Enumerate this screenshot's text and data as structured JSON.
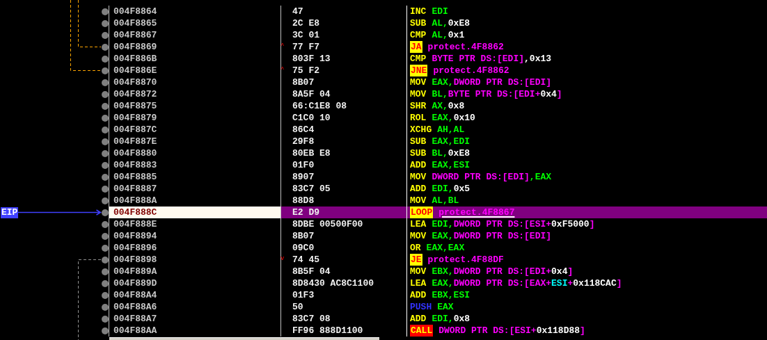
{
  "eip_label": "EIP",
  "rows": [
    {
      "address": "004F8864",
      "bytes": "47",
      "selected": false,
      "instruction": [
        {
          "text": "INC",
          "kind": "mnemonic"
        },
        {
          "text": "EDI",
          "kind": "register"
        }
      ]
    },
    {
      "address": "004F8865",
      "bytes": "2C E8",
      "selected": false,
      "instruction": [
        {
          "text": "SUB",
          "kind": "mnemonic"
        },
        {
          "text": "AL,",
          "kind": "register"
        },
        {
          "text": "0xE8",
          "kind": "number"
        }
      ]
    },
    {
      "address": "004F8867",
      "bytes": "3C 01",
      "selected": false,
      "instruction": [
        {
          "text": "CMP",
          "kind": "mnemonic"
        },
        {
          "text": "AL,",
          "kind": "register"
        },
        {
          "text": "0x1",
          "kind": "number"
        }
      ]
    },
    {
      "address": "004F8869",
      "bytes": "77 F7",
      "jump_mark": "^",
      "selected": false,
      "instruction": [
        {
          "text": "JA",
          "kind": "jump"
        },
        {
          "text": "protect.4F8862",
          "kind": "label"
        }
      ]
    },
    {
      "address": "004F886B",
      "bytes": "803F 13",
      "selected": false,
      "instruction": [
        {
          "text": "CMP",
          "kind": "mnemonic"
        },
        {
          "text": "BYTE PTR DS:[EDI]",
          "kind": "memory"
        },
        {
          "text": ",0x13",
          "kind": "number"
        }
      ]
    },
    {
      "address": "004F886E",
      "bytes": "75 F2",
      "jump_mark": "^",
      "selected": false,
      "instruction": [
        {
          "text": "JNE",
          "kind": "jump"
        },
        {
          "text": "protect.4F8862",
          "kind": "label"
        }
      ]
    },
    {
      "address": "004F8870",
      "bytes": "8B07",
      "selected": false,
      "instruction": [
        {
          "text": "MOV",
          "kind": "mnemonic"
        },
        {
          "text": "EAX,",
          "kind": "register"
        },
        {
          "text": "DWORD PTR DS:[EDI]",
          "kind": "memory"
        }
      ]
    },
    {
      "address": "004F8872",
      "bytes": "8A5F 04",
      "selected": false,
      "instruction": [
        {
          "text": "MOV",
          "kind": "mnemonic"
        },
        {
          "text": "BL,",
          "kind": "register"
        },
        {
          "text": "BYTE PTR DS:[EDI+",
          "kind": "memory"
        },
        {
          "text": "0x4",
          "kind": "number"
        },
        {
          "text": "]",
          "kind": "memory"
        }
      ]
    },
    {
      "address": "004F8875",
      "bytes": "66:C1E8 08",
      "selected": false,
      "instruction": [
        {
          "text": "SHR",
          "kind": "mnemonic"
        },
        {
          "text": "AX,",
          "kind": "register"
        },
        {
          "text": "0x8",
          "kind": "number"
        }
      ]
    },
    {
      "address": "004F8879",
      "bytes": "C1C0 10",
      "selected": false,
      "instruction": [
        {
          "text": "ROL",
          "kind": "mnemonic"
        },
        {
          "text": "EAX,",
          "kind": "register"
        },
        {
          "text": "0x10",
          "kind": "number"
        }
      ]
    },
    {
      "address": "004F887C",
      "bytes": "86C4",
      "selected": false,
      "instruction": [
        {
          "text": "XCHG",
          "kind": "mnemonic"
        },
        {
          "text": "AH,AL",
          "kind": "register"
        }
      ]
    },
    {
      "address": "004F887E",
      "bytes": "29F8",
      "selected": false,
      "instruction": [
        {
          "text": "SUB",
          "kind": "mnemonic"
        },
        {
          "text": "EAX,EDI",
          "kind": "register"
        }
      ]
    },
    {
      "address": "004F8880",
      "bytes": "80EB E8",
      "selected": false,
      "instruction": [
        {
          "text": "SUB",
          "kind": "mnemonic"
        },
        {
          "text": "BL,",
          "kind": "register"
        },
        {
          "text": "0xE8",
          "kind": "number"
        }
      ]
    },
    {
      "address": "004F8883",
      "bytes": "01F0",
      "selected": false,
      "instruction": [
        {
          "text": "ADD",
          "kind": "mnemonic"
        },
        {
          "text": "EAX,ESI",
          "kind": "register"
        }
      ]
    },
    {
      "address": "004F8885",
      "bytes": "8907",
      "selected": false,
      "instruction": [
        {
          "text": "MOV",
          "kind": "mnemonic"
        },
        {
          "text": "DWORD PTR DS:[EDI]",
          "kind": "memory"
        },
        {
          "text": ",EAX",
          "kind": "register"
        }
      ]
    },
    {
      "address": "004F8887",
      "bytes": "83C7 05",
      "selected": false,
      "instruction": [
        {
          "text": "ADD",
          "kind": "mnemonic"
        },
        {
          "text": "EDI,",
          "kind": "register"
        },
        {
          "text": "0x5",
          "kind": "number"
        }
      ]
    },
    {
      "address": "004F888A",
      "bytes": "88D8",
      "selected": false,
      "instruction": [
        {
          "text": "MOV",
          "kind": "mnemonic"
        },
        {
          "text": "AL,BL",
          "kind": "register"
        }
      ]
    },
    {
      "address": "004F888C",
      "bytes": "E2 D9",
      "selected": true,
      "instruction": [
        {
          "text": "LOOP",
          "kind": "jump"
        },
        {
          "text": "protect.4F8867",
          "kind": "label"
        }
      ]
    },
    {
      "address": "004F888E",
      "bytes": "8DBE 00500F00",
      "selected": false,
      "instruction": [
        {
          "text": "LEA",
          "kind": "mnemonic"
        },
        {
          "text": "EDI,",
          "kind": "register"
        },
        {
          "text": "DWORD PTR DS:[ESI+",
          "kind": "memory"
        },
        {
          "text": "0xF5000",
          "kind": "number"
        },
        {
          "text": "]",
          "kind": "memory"
        }
      ]
    },
    {
      "address": "004F8894",
      "bytes": "8B07",
      "selected": false,
      "instruction": [
        {
          "text": "MOV",
          "kind": "mnemonic"
        },
        {
          "text": "EAX,",
          "kind": "register"
        },
        {
          "text": "DWORD PTR DS:[EDI]",
          "kind": "memory"
        }
      ]
    },
    {
      "address": "004F8896",
      "bytes": "09C0",
      "selected": false,
      "instruction": [
        {
          "text": "OR",
          "kind": "mnemonic"
        },
        {
          "text": "EAX,EAX",
          "kind": "register"
        }
      ]
    },
    {
      "address": "004F8898",
      "bytes": "74 45",
      "jump_mark": "v",
      "selected": false,
      "instruction": [
        {
          "text": "JE",
          "kind": "jump"
        },
        {
          "text": "protect.4F88DF",
          "kind": "label"
        }
      ]
    },
    {
      "address": "004F889A",
      "bytes": "8B5F 04",
      "selected": false,
      "instruction": [
        {
          "text": "MOV",
          "kind": "mnemonic"
        },
        {
          "text": "EBX,",
          "kind": "register"
        },
        {
          "text": "DWORD PTR DS:[EDI+",
          "kind": "memory"
        },
        {
          "text": "0x4",
          "kind": "number"
        },
        {
          "text": "]",
          "kind": "memory"
        }
      ]
    },
    {
      "address": "004F889D",
      "bytes": "8D8430 AC8C1100",
      "selected": false,
      "instruction": [
        {
          "text": "LEA",
          "kind": "mnemonic"
        },
        {
          "text": "EAX,",
          "kind": "register"
        },
        {
          "text": "DWORD PTR DS:[EAX+",
          "kind": "memory"
        },
        {
          "text": "ESI",
          "kind": "index"
        },
        {
          "text": "+",
          "kind": "memory"
        },
        {
          "text": "0x118CAC",
          "kind": "number"
        },
        {
          "text": "]",
          "kind": "memory"
        }
      ]
    },
    {
      "address": "004F88A4",
      "bytes": "01F3",
      "selected": false,
      "instruction": [
        {
          "text": "ADD",
          "kind": "mnemonic"
        },
        {
          "text": "EBX,ESI",
          "kind": "register"
        }
      ]
    },
    {
      "address": "004F88A6",
      "bytes": "50",
      "selected": false,
      "instruction": [
        {
          "text": "PUSH",
          "kind": "stack"
        },
        {
          "text": "EAX",
          "kind": "register"
        }
      ]
    },
    {
      "address": "004F88A7",
      "bytes": "83C7 08",
      "selected": false,
      "instruction": [
        {
          "text": "ADD",
          "kind": "mnemonic"
        },
        {
          "text": "EDI,",
          "kind": "register"
        },
        {
          "text": "0x8",
          "kind": "number"
        }
      ]
    },
    {
      "address": "004F88AA",
      "bytes": "FF96 888D1100",
      "selected": false,
      "instruction": [
        {
          "text": "CALL",
          "kind": "call"
        },
        {
          "text": "DWORD PTR DS:[ESI+",
          "kind": "memory"
        },
        {
          "text": "0x118D88",
          "kind": "number"
        },
        {
          "text": "]",
          "kind": "memory"
        }
      ]
    }
  ]
}
